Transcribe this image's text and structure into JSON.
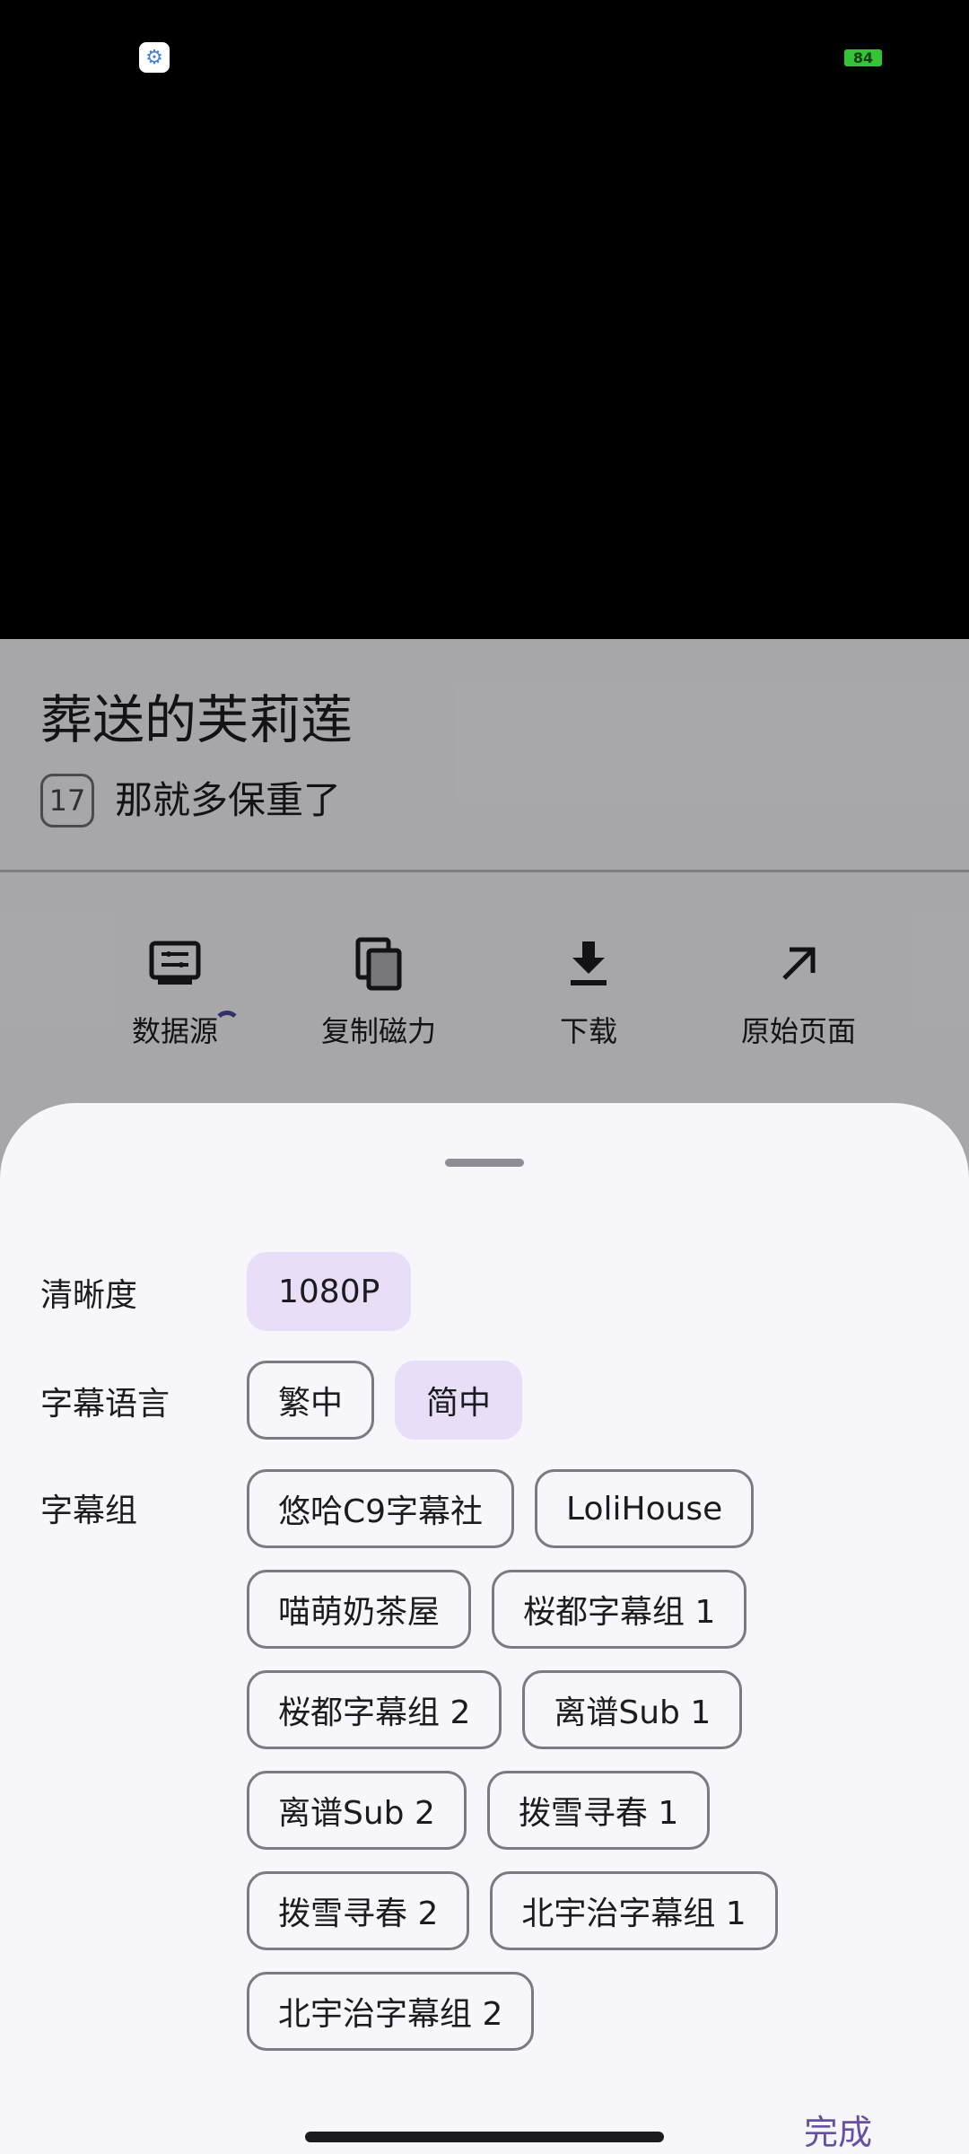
{
  "status_bar": {
    "app_icon": "gear-icon",
    "battery_level": "84",
    "battery_color": "#35c435"
  },
  "details": {
    "title": "葬送的芙莉莲",
    "episode_number": "17",
    "episode_title": "那就多保重了"
  },
  "actions": [
    {
      "label": "数据源",
      "icon": "data-source-icon",
      "loading": true
    },
    {
      "label": "复制磁力",
      "icon": "copy-icon"
    },
    {
      "label": "下载",
      "icon": "download-icon"
    },
    {
      "label": "原始页面",
      "icon": "open-external-icon"
    }
  ],
  "sheet": {
    "resolution": {
      "label": "清晰度",
      "options": [
        {
          "label": "1080P",
          "selected": true
        }
      ]
    },
    "subtitle_language": {
      "label": "字幕语言",
      "options": [
        {
          "label": "繁中",
          "selected": false
        },
        {
          "label": "简中",
          "selected": true
        }
      ]
    },
    "subtitle_group": {
      "label": "字幕组",
      "options": [
        {
          "label": "悠哈C9字幕社"
        },
        {
          "label": "LoliHouse"
        },
        {
          "label": "喵萌奶茶屋"
        },
        {
          "label": "桜都字幕组 1"
        },
        {
          "label": "桜都字幕组 2"
        },
        {
          "label": "离谱Sub 1"
        },
        {
          "label": "离谱Sub 2"
        },
        {
          "label": "拨雪寻春 1"
        },
        {
          "label": "拨雪寻春 2"
        },
        {
          "label": "北宇治字幕组 1"
        },
        {
          "label": "北宇治字幕组 2"
        }
      ]
    },
    "done_label": "完成",
    "accent_color": "#6750a4",
    "selected_chip_color": "#e8def8"
  }
}
